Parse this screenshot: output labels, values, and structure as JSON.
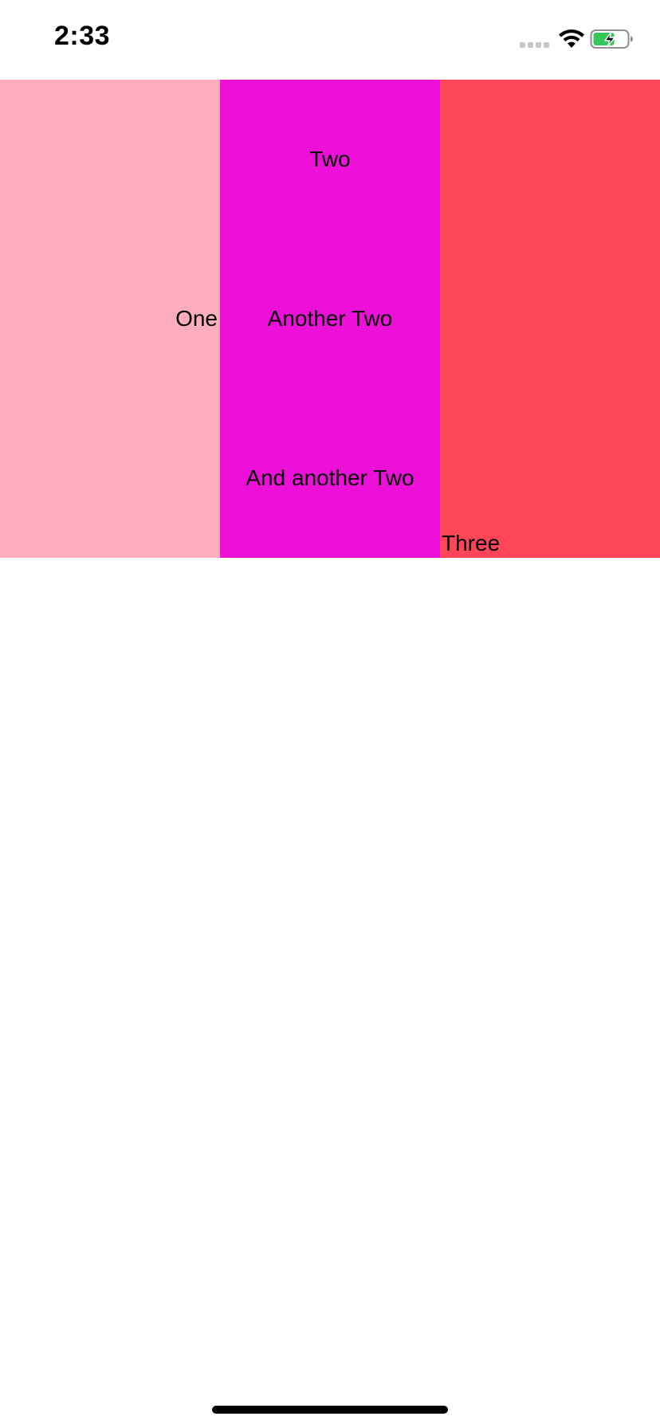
{
  "status_bar": {
    "time": "2:33",
    "signal_icon": "cellular-signal-icon",
    "wifi_icon": "wifi-icon",
    "battery_icon": "battery-charging-icon",
    "battery_color": "#34c759",
    "signal_color": "#c7c7c7"
  },
  "columns": [
    {
      "name": "one",
      "color": "#fdadbb",
      "labels": [
        "One"
      ]
    },
    {
      "name": "two",
      "color": "#ec10d8",
      "labels": [
        "Two",
        "Another Two",
        "And another Two"
      ]
    },
    {
      "name": "three",
      "color": "#ff4659",
      "labels": [
        "Three"
      ]
    }
  ],
  "background": "#fffdfd"
}
